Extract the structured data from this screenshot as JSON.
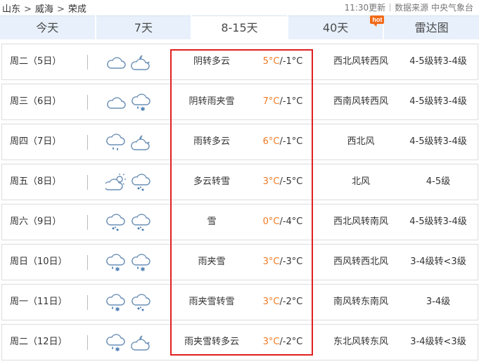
{
  "breadcrumb": [
    "山东",
    "威海",
    "荣成"
  ],
  "breadcrumb_sep": ">",
  "update_time": "11:30更新",
  "data_source": "数据来源 中央气象台",
  "tabs": [
    {
      "label": "今天",
      "active": false
    },
    {
      "label": "7天",
      "active": false
    },
    {
      "label": "8-15天",
      "active": true
    },
    {
      "label": "40天",
      "active": false,
      "badge": "hot"
    },
    {
      "label": "雷达图",
      "active": false
    }
  ],
  "days": [
    {
      "date": "周二（5日）",
      "icon1": "cloudy-icon",
      "icon2": "partly-cloudy-night-icon",
      "desc": "阴转多云",
      "hi": "5°C",
      "lo": "/-1°C",
      "wind": "西北风转西风",
      "level": "4-5级转3-4级"
    },
    {
      "date": "周三（6日）",
      "icon1": "cloudy-icon",
      "icon2": "sleet-icon",
      "desc": "阴转雨夹雪",
      "hi": "7°C",
      "lo": "/-1°C",
      "wind": "西南风转西风",
      "level": "4-5级转3-4级"
    },
    {
      "date": "周四（7日）",
      "icon1": "rain-icon",
      "icon2": "partly-cloudy-night-icon",
      "desc": "雨转多云",
      "hi": "6°C",
      "lo": "/-1°C",
      "wind": "西北风",
      "level": "4-5级转3-4级"
    },
    {
      "date": "周五（8日）",
      "icon1": "partly-cloudy-day-icon",
      "icon2": "snow-icon",
      "desc": "多云转雪",
      "hi": "3°C",
      "lo": "/-5°C",
      "wind": "北风",
      "level": "4-5级"
    },
    {
      "date": "周六（9日）",
      "icon1": "snow-icon",
      "icon2": "snow-icon",
      "desc": "雪",
      "hi": "0°C",
      "lo": "/-4°C",
      "wind": "西北风转南风",
      "level": "4-5级转3-4级"
    },
    {
      "date": "周日（10日）",
      "icon1": "sleet-icon",
      "icon2": "sleet-icon",
      "desc": "雨夹雪",
      "hi": "3°C",
      "lo": "/-3°C",
      "wind": "西风转西北风",
      "level": "3-4级转<3级"
    },
    {
      "date": "周一（11日）",
      "icon1": "sleet-icon",
      "icon2": "snow-icon",
      "desc": "雨夹雪转雪",
      "hi": "3°C",
      "lo": "/-2°C",
      "wind": "南风转东南风",
      "level": "3-4级"
    },
    {
      "date": "周二（12日）",
      "icon1": "sleet-icon",
      "icon2": "partly-cloudy-night-icon",
      "desc": "雨夹雪转多云",
      "hi": "3°C",
      "lo": "/-2°C",
      "wind": "东北风转东风",
      "level": "3-4级转<3级"
    }
  ],
  "colors": {
    "high_temp": "#f07a23",
    "highlight_box": "#e02020",
    "tab_bg": "#e7f0fb",
    "badge": "#f26a19"
  }
}
